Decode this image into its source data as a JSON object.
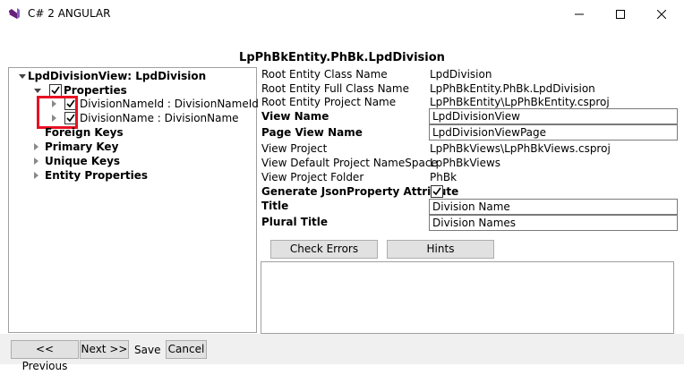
{
  "window": {
    "title": "C# 2 ANGULAR",
    "controls": {
      "minimize": "minimize-icon",
      "maximize": "maximize-icon",
      "close": "close-icon"
    },
    "app_icon": "visual-studio-icon",
    "icon_color": "#68217a"
  },
  "header": {
    "title": "LpPhBkEntity.PhBk.LpdDivision"
  },
  "tree": {
    "root": "LpdDivisionView: LpdDivision",
    "properties": "Properties",
    "property_items": [
      "DivisionNameId : DivisionNameId",
      "DivisionName : DivisionName"
    ],
    "foreign_keys": "Foreign Keys",
    "primary_key": "Primary Key",
    "unique_keys": "Unique Keys",
    "entity_properties": "Entity Properties"
  },
  "details": {
    "root_class_label": "Root Entity Class Name",
    "root_class_value": "LpdDivision",
    "root_full_label": "Root Entity Full Class Name",
    "root_full_value": "LpPhBkEntity.PhBk.LpdDivision",
    "root_project_label": "Root Entity Project Name",
    "root_project_value": "LpPhBkEntity\\LpPhBkEntity.csproj",
    "view_name_label": "View Name",
    "view_name_value": "LpdDivisionView",
    "page_view_label": "Page View Name",
    "page_view_value": "LpdDivisionViewPage",
    "view_project_label": "View Project",
    "view_project_value": "LpPhBkViews\\LpPhBkViews.csproj",
    "namespace_label": "View Default Project NameSpace",
    "namespace_value": "LpPhBkViews",
    "folder_label": "View Project Folder",
    "folder_value": "PhBk",
    "json_attr_label": "Generate JsonProperty Attribute",
    "title_label": "Title",
    "title_value": "Division Name",
    "plural_label": "Plural Title",
    "plural_value": "Division Names"
  },
  "actions": {
    "check_errors": "Check Errors",
    "hints": "Hints"
  },
  "footer": {
    "previous": "<< Previous",
    "next": "Next >>",
    "save": "Save",
    "cancel": "Cancel"
  },
  "colors": {
    "highlight": "#e81123",
    "button_bg": "#e1e1e1",
    "border": "#a0a0a0"
  }
}
